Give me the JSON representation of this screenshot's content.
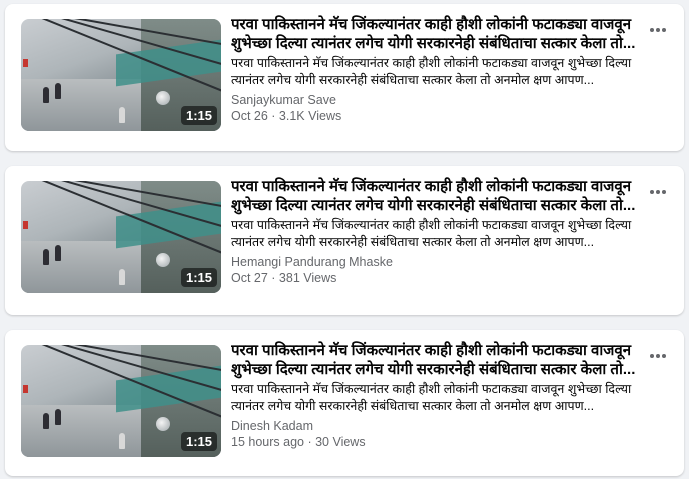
{
  "videos": [
    {
      "title": "परवा पाकिस्तानने मॅच जिंकल्यानंतर काही हौशी लोकांनी फटाकड्या वाजवून शुभेच्छा दिल्या त्यानंतर लगेच योगी सरकारनेही संबंधिताचा सत्कार केला तो...",
      "description": "परवा पाकिस्तानने मॅच जिंकल्यानंतर काही हौशी लोकांनी फटाकड्या वाजवून शुभेच्छा दिल्या त्यानंतर लगेच योगी सरकारनेही संबंधिताचा सत्कार केला तो अनमोल क्षण आपण...",
      "duration": "1:15",
      "author": "Sanjaykumar Save",
      "meta": "Oct 26 · 3.1K Views",
      "more_icon": "more-options-icon"
    },
    {
      "title": "परवा पाकिस्तानने मॅच जिंकल्यानंतर काही हौशी लोकांनी फटाकड्या वाजवून शुभेच्छा दिल्या त्यानंतर लगेच योगी सरकारनेही संबंधिताचा सत्कार केला तो...",
      "description": "परवा पाकिस्तानने मॅच जिंकल्यानंतर काही हौशी लोकांनी फटाकड्या वाजवून शुभेच्छा दिल्या त्यानंतर लगेच योगी सरकारनेही संबंधिताचा सत्कार केला तो अनमोल क्षण आपण...",
      "duration": "1:15",
      "author": "Hemangi Pandurang Mhaske",
      "meta": "Oct 27 · 381 Views",
      "more_icon": "more-options-icon"
    },
    {
      "title": "परवा पाकिस्तानने मॅच जिंकल्यानंतर काही हौशी लोकांनी फटाकड्या वाजवून शुभेच्छा दिल्या त्यानंतर लगेच योगी सरकारनेही संबंधिताचा सत्कार केला तो...",
      "description": "परवा पाकिस्तानने मॅच जिंकल्यानंतर काही हौशी लोकांनी फटाकड्या वाजवून शुभेच्छा दिल्या त्यानंतर लगेच योगी सरकारनेही संबंधिताचा सत्कार केला तो अनमोल क्षण आपण...",
      "duration": "1:15",
      "author": "Dinesh Kadam",
      "meta": "15 hours ago · 30 Views",
      "more_icon": "more-options-icon"
    }
  ],
  "colors": {
    "page_bg": "#f0f2f5",
    "card_bg": "#ffffff",
    "primary_text": "#050505",
    "secondary_text": "#65676b"
  }
}
